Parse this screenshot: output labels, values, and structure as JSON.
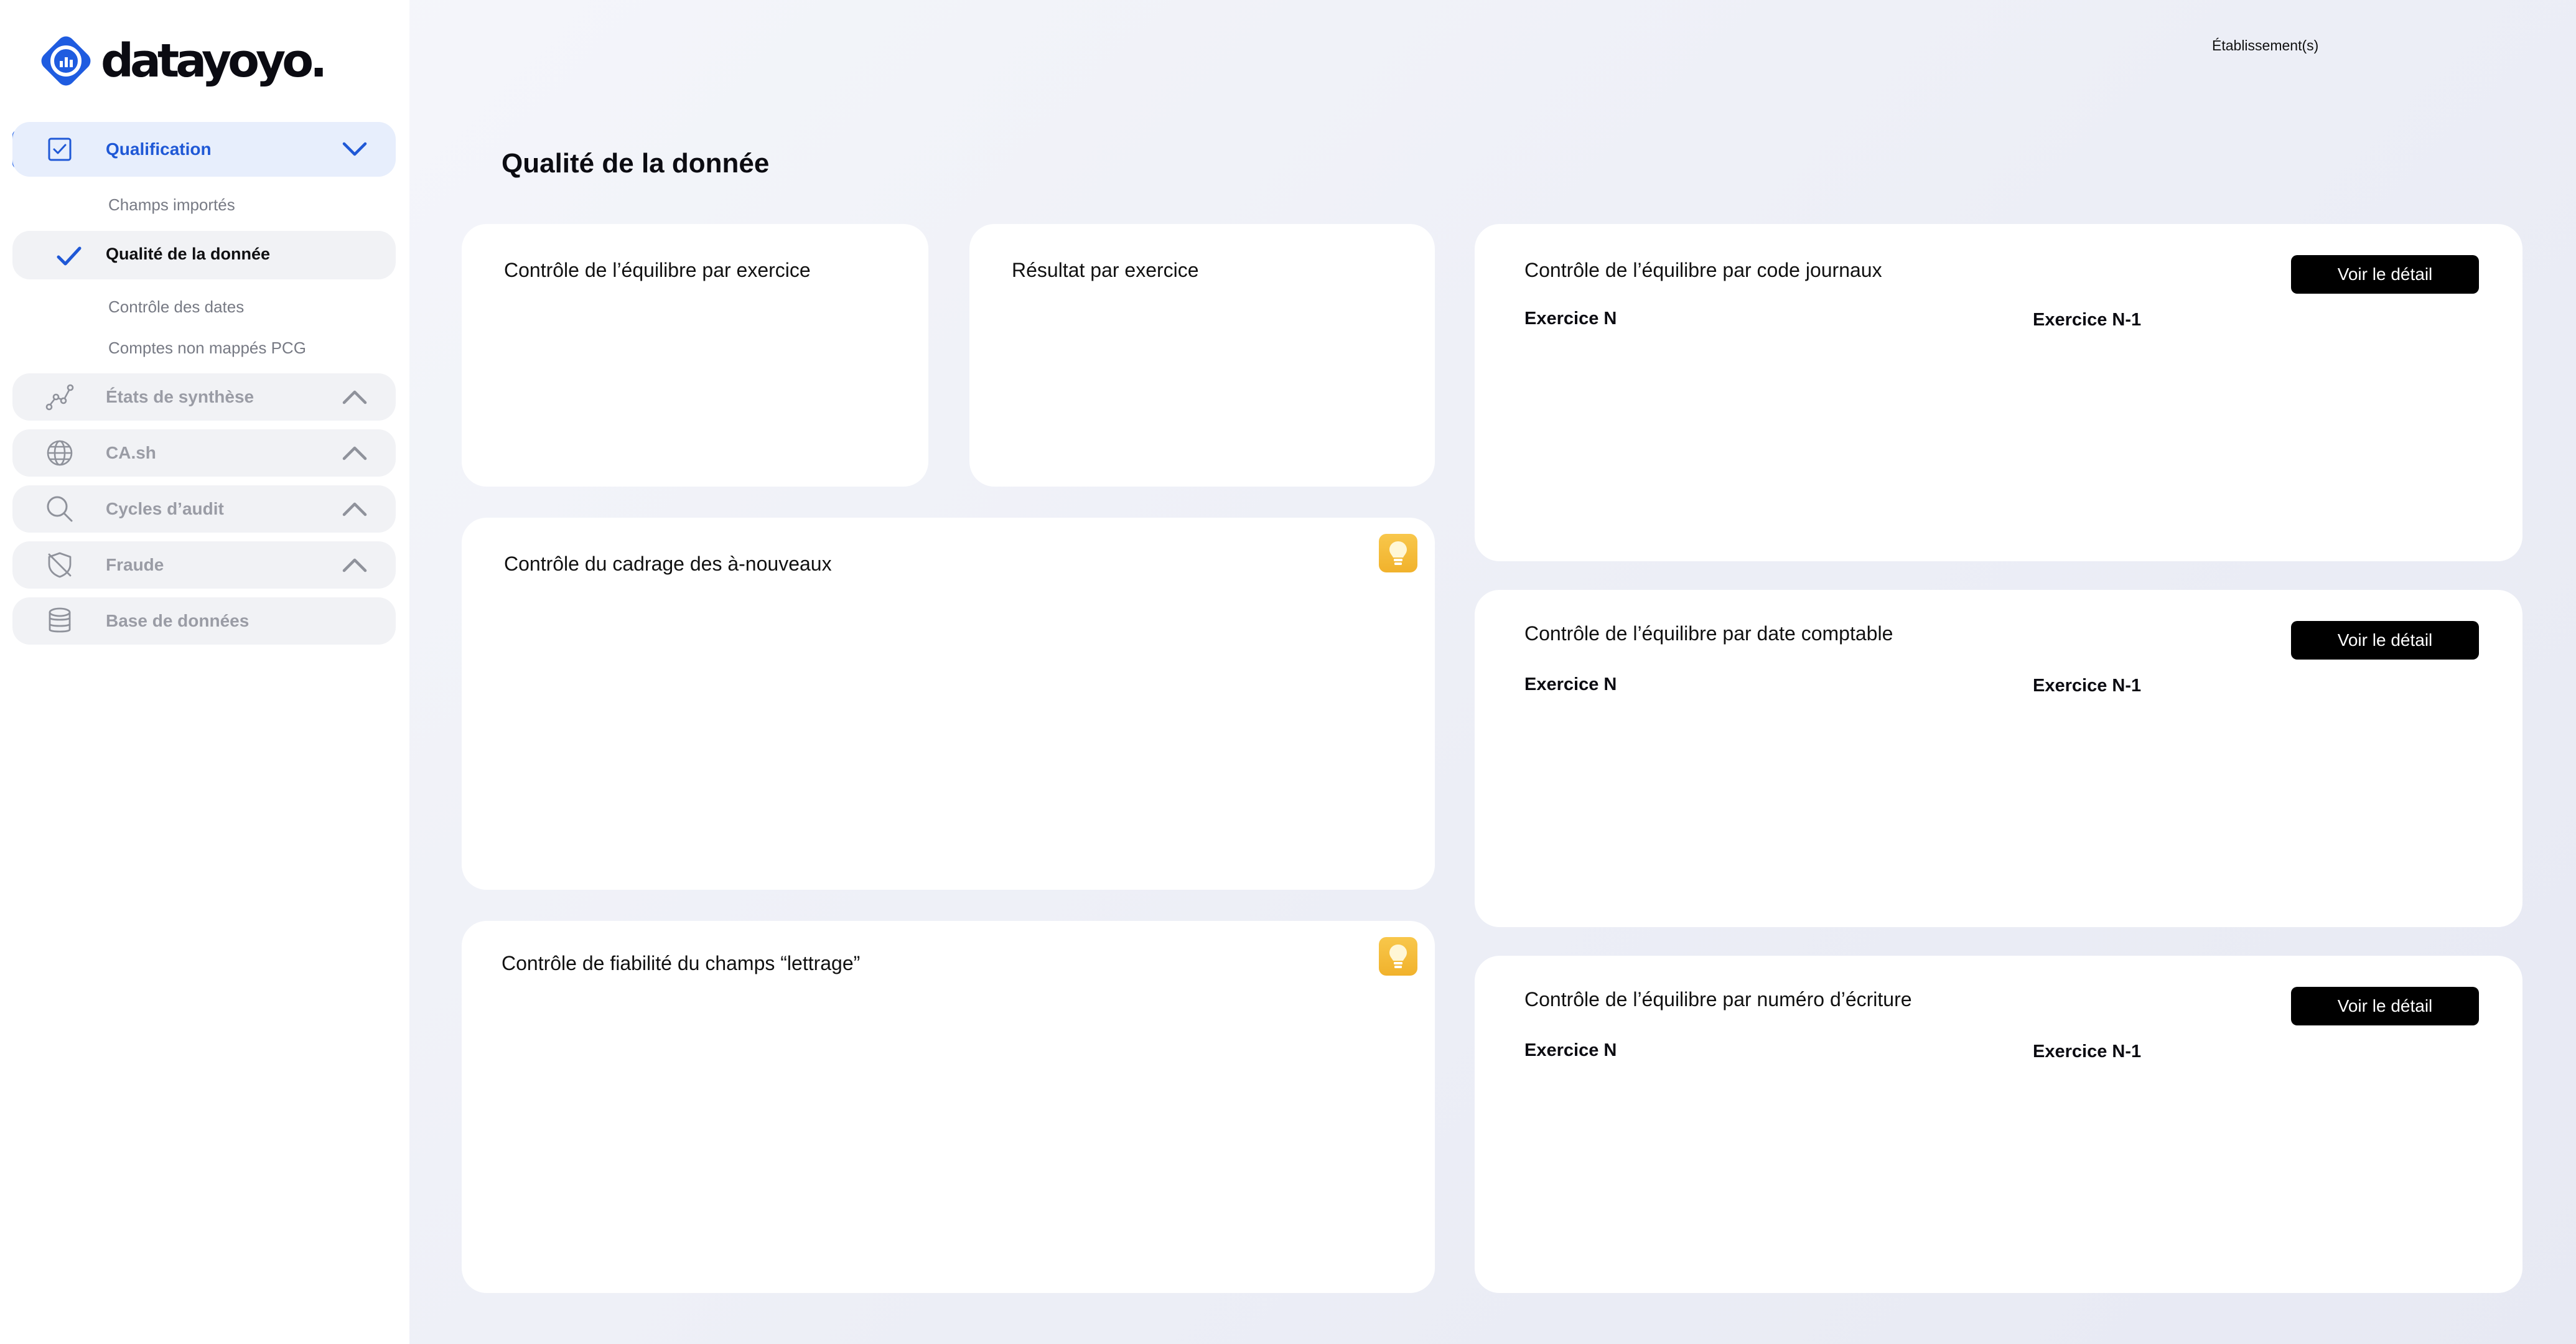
{
  "brand": {
    "name": "datayoyo",
    "dot": "."
  },
  "colors": {
    "accent": "#2363e9",
    "active_bg": "#e7eefc",
    "hint": "#f4bb35"
  },
  "sidebar": {
    "qualification": {
      "label": "Qualification",
      "icon": "checkbox-icon",
      "expanded": true
    },
    "sub_items": [
      {
        "label": "Champs importés"
      },
      {
        "label": "Qualité de la donnée",
        "current": true
      },
      {
        "label": "Contrôle des dates"
      },
      {
        "label": "Comptes non mappés PCG"
      }
    ],
    "items": [
      {
        "label": "États de synthèse",
        "icon": "line-chart-icon"
      },
      {
        "label": "CA.sh",
        "icon": "globe-icon"
      },
      {
        "label": "Cycles d’audit",
        "icon": "search-icon"
      },
      {
        "label": "Fraude",
        "icon": "shield-off-icon"
      },
      {
        "label": "Base de données",
        "icon": "database-icon"
      }
    ]
  },
  "header": {
    "establishments": "Établissement(s)"
  },
  "page": {
    "title": "Qualité de la donnée"
  },
  "cards": {
    "equilibre_exercice": {
      "title": "Contrôle de l’équilibre par exercice"
    },
    "resultat_exercice": {
      "title": "Résultat par exercice"
    },
    "cadrage": {
      "title": "Contrôle du cadrage des à-nouveaux"
    },
    "lettrage": {
      "title": "Contrôle de fiabilité du champs “lettrage”"
    },
    "code_journaux": {
      "title": "Contrôle de l’équilibre par code journaux",
      "button": "Voir le détail",
      "col_n": "Exercice N",
      "col_n1": "Exercice N-1"
    },
    "date_comptable": {
      "title": "Contrôle de l’équilibre par date comptable",
      "button": "Voir le détail",
      "col_n": "Exercice N",
      "col_n1": "Exercice N-1"
    },
    "numero_ecriture": {
      "title": "Contrôle de l’équilibre par numéro d’écriture",
      "button": "Voir le détail",
      "col_n": "Exercice N",
      "col_n1": "Exercice N-1"
    }
  }
}
